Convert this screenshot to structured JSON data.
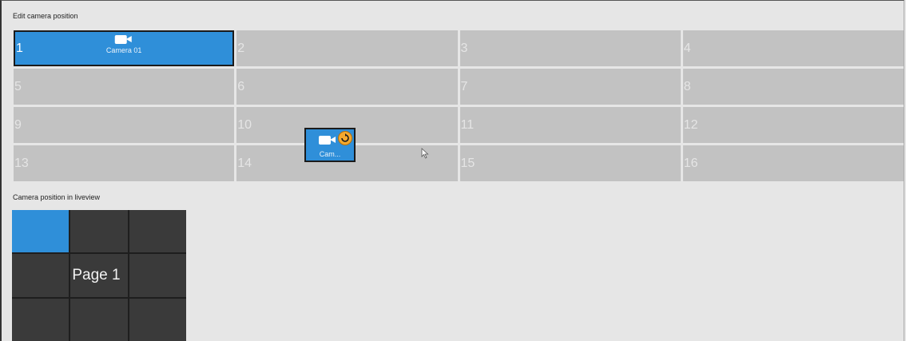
{
  "header": {
    "title": "Edit camera position"
  },
  "camera_grid": {
    "cells": [
      {
        "number": "1",
        "camera": "Camera 01"
      },
      {
        "number": "2"
      },
      {
        "number": "3"
      },
      {
        "number": "4"
      },
      {
        "number": "5"
      },
      {
        "number": "6"
      },
      {
        "number": "7"
      },
      {
        "number": "8"
      },
      {
        "number": "9"
      },
      {
        "number": "10"
      },
      {
        "number": "11"
      },
      {
        "number": "12"
      },
      {
        "number": "13"
      },
      {
        "number": "14"
      },
      {
        "number": "15"
      },
      {
        "number": "16"
      }
    ]
  },
  "drag_tile": {
    "label": "Cam...",
    "icon": "camera-icon",
    "badge_icon": "swap-icon"
  },
  "liveview": {
    "title": "Camera position in liveview",
    "page_label": "Page 1",
    "active_cell": 1
  },
  "colors": {
    "accent": "#2f8fd9",
    "badge": "#f4a82c",
    "cell": "#c2c2c2",
    "liveview_cell": "#3a3a3a"
  }
}
